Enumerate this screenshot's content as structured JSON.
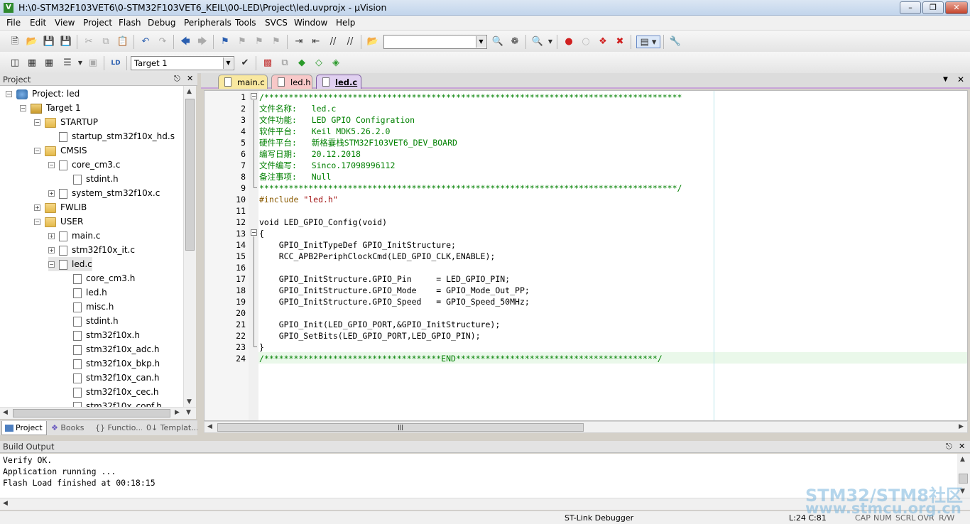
{
  "window": {
    "title": "H:\\0-STM32F103VET6\\0-STM32F103VET6_KEIL\\00-LED\\Project\\led.uvprojx - µVision"
  },
  "menu": [
    "File",
    "Edit",
    "View",
    "Project",
    "Flash",
    "Debug",
    "Peripherals",
    "Tools",
    "SVCS",
    "Window",
    "Help"
  ],
  "toolbar": {
    "search_value": "",
    "target_value": "Target 1"
  },
  "project_panel": {
    "title": "Project",
    "tree": [
      {
        "label": "Project: led",
        "level": 0,
        "icon": "project-icon",
        "expander": "−"
      },
      {
        "label": "Target 1",
        "level": 1,
        "icon": "target-icon",
        "expander": "−"
      },
      {
        "label": "STARTUP",
        "level": 2,
        "icon": "folder-icon",
        "expander": "−"
      },
      {
        "label": "startup_stm32f10x_hd.s",
        "level": 3,
        "icon": "file-icon",
        "expander": ""
      },
      {
        "label": "CMSIS",
        "level": 2,
        "icon": "folder-icon",
        "expander": "−"
      },
      {
        "label": "core_cm3.c",
        "level": 3,
        "icon": "file-icon",
        "expander": "−"
      },
      {
        "label": "stdint.h",
        "level": 4,
        "icon": "file-icon",
        "expander": ""
      },
      {
        "label": "system_stm32f10x.c",
        "level": 3,
        "icon": "file-icon",
        "expander": "+"
      },
      {
        "label": "FWLIB",
        "level": 2,
        "icon": "folder-icon",
        "expander": "+"
      },
      {
        "label": "USER",
        "level": 2,
        "icon": "folder-icon",
        "expander": "−"
      },
      {
        "label": "main.c",
        "level": 3,
        "icon": "file-icon",
        "expander": "+"
      },
      {
        "label": "stm32f10x_it.c",
        "level": 3,
        "icon": "file-icon",
        "expander": "+"
      },
      {
        "label": "led.c",
        "level": 3,
        "icon": "file-icon",
        "expander": "−"
      },
      {
        "label": "core_cm3.h",
        "level": 4,
        "icon": "file-icon",
        "expander": ""
      },
      {
        "label": "led.h",
        "level": 4,
        "icon": "file-icon",
        "expander": ""
      },
      {
        "label": "misc.h",
        "level": 4,
        "icon": "file-icon",
        "expander": ""
      },
      {
        "label": "stdint.h",
        "level": 4,
        "icon": "file-icon",
        "expander": ""
      },
      {
        "label": "stm32f10x.h",
        "level": 4,
        "icon": "file-icon",
        "expander": ""
      },
      {
        "label": "stm32f10x_adc.h",
        "level": 4,
        "icon": "file-icon",
        "expander": ""
      },
      {
        "label": "stm32f10x_bkp.h",
        "level": 4,
        "icon": "file-icon",
        "expander": ""
      },
      {
        "label": "stm32f10x_can.h",
        "level": 4,
        "icon": "file-icon",
        "expander": ""
      },
      {
        "label": "stm32f10x_cec.h",
        "level": 4,
        "icon": "file-icon",
        "expander": ""
      },
      {
        "label": "stm32f10x_conf.h",
        "level": 4,
        "icon": "file-icon",
        "expander": ""
      }
    ],
    "tabs": [
      "Project",
      "Books",
      "{} Functio...",
      "0↓ Templat..."
    ]
  },
  "editor": {
    "tabs": [
      {
        "label": "main.c",
        "color": "#f9e8a0"
      },
      {
        "label": "led.h",
        "color": "#f8c8c8"
      },
      {
        "label": "led.c",
        "color": "#e0d0f0",
        "active": true
      }
    ],
    "lines": [
      {
        "n": "1",
        "parts": [
          [
            "cm",
            "/*************************************************************************************"
          ]
        ]
      },
      {
        "n": "2",
        "parts": [
          [
            "cm",
            "文件名称:   led.c"
          ]
        ]
      },
      {
        "n": "3",
        "parts": [
          [
            "cm",
            "文件功能:   LED GPIO Configration"
          ]
        ]
      },
      {
        "n": "4",
        "parts": [
          [
            "cm",
            "软件平台:   Keil MDK5.26.2.0"
          ]
        ]
      },
      {
        "n": "5",
        "parts": [
          [
            "cm",
            "硬件平台:   新格霎栈STM32F103VET6_DEV_BOARD"
          ]
        ]
      },
      {
        "n": "6",
        "parts": [
          [
            "cm",
            "编写日期:   20.12.2018"
          ]
        ]
      },
      {
        "n": "7",
        "parts": [
          [
            "cm",
            "文件编写:   Sinco.17098996112"
          ]
        ]
      },
      {
        "n": "8",
        "parts": [
          [
            "cm",
            "备注事项:   Null"
          ]
        ]
      },
      {
        "n": "9",
        "parts": [
          [
            "cm",
            "*************************************************************************************/"
          ]
        ]
      },
      {
        "n": "10",
        "parts": [
          [
            "pp",
            "#include "
          ],
          [
            "str",
            "\"led.h\""
          ]
        ]
      },
      {
        "n": "11",
        "parts": [
          [
            "",
            ""
          ]
        ]
      },
      {
        "n": "12",
        "parts": [
          [
            "",
            "void LED_GPIO_Config(void)"
          ]
        ]
      },
      {
        "n": "13",
        "parts": [
          [
            "",
            "{"
          ]
        ]
      },
      {
        "n": "14",
        "parts": [
          [
            "",
            "    GPIO_InitTypeDef GPIO_InitStructure;"
          ]
        ]
      },
      {
        "n": "15",
        "parts": [
          [
            "",
            "    RCC_APB2PeriphClockCmd(LED_GPIO_CLK,ENABLE);"
          ]
        ]
      },
      {
        "n": "16",
        "parts": [
          [
            "",
            ""
          ]
        ]
      },
      {
        "n": "17",
        "parts": [
          [
            "",
            "    GPIO_InitStructure.GPIO_Pin     = LED_GPIO_PIN;"
          ]
        ]
      },
      {
        "n": "18",
        "parts": [
          [
            "",
            "    GPIO_InitStructure.GPIO_Mode    = GPIO_Mode_Out_PP;"
          ]
        ]
      },
      {
        "n": "19",
        "parts": [
          [
            "",
            "    GPIO_InitStructure.GPIO_Speed   = GPIO_Speed_50MHz;"
          ]
        ]
      },
      {
        "n": "20",
        "parts": [
          [
            "",
            ""
          ]
        ]
      },
      {
        "n": "21",
        "parts": [
          [
            "",
            "    GPIO_Init(LED_GPIO_PORT,&GPIO_InitStructure);"
          ]
        ]
      },
      {
        "n": "22",
        "parts": [
          [
            "",
            "    GPIO_SetBits(LED_GPIO_PORT,LED_GPIO_PIN);"
          ]
        ]
      },
      {
        "n": "23",
        "parts": [
          [
            "",
            "}"
          ]
        ]
      },
      {
        "n": "24",
        "parts": [
          [
            "cm",
            "/************************************END*****************************************/"
          ]
        ]
      }
    ]
  },
  "build_output": {
    "title": "Build Output",
    "lines": [
      "Verify OK.",
      "Application running ...",
      "Flash Load finished at 00:18:15"
    ]
  },
  "status": {
    "debugger": "ST-Link Debugger",
    "position": "L:24 C:81",
    "cap": "CAP",
    "num": "NUM",
    "scrl": "SCRL",
    "ovr": "OVR",
    "rw": "R/W"
  },
  "watermark": {
    "line1": "STM32/STM8社区",
    "line2": "www.stmcu.org.cn"
  }
}
